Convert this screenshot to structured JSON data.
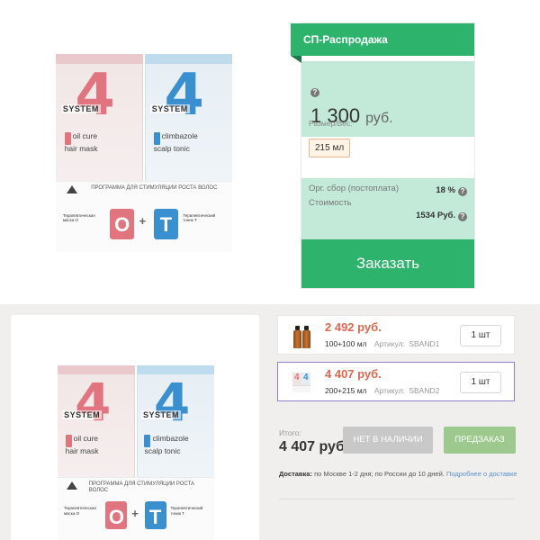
{
  "product": {
    "mask": {
      "brand": "SYSTEM",
      "digit": "4",
      "line1": "oil cure",
      "line2": "hair mask"
    },
    "tonic": {
      "brand": "SYSTEM",
      "digit": "4",
      "line1": "climbazole",
      "line2": "scalp tonic"
    },
    "program": "ПРОГРАММА ДЛЯ СТИМУЛЯЦИИ РОСТА ВОЛОС",
    "therapy_left": "Терапевтическая маска О",
    "therapy_right": "Терапевтический тоник Т",
    "glyph_o": "O",
    "glyph_t": "T",
    "plus": "+"
  },
  "card": {
    "header": "СП-Распродажа",
    "price": "1 300",
    "currency": "руб.",
    "size_label": "Размер/Вес:",
    "size_value": "215 мл",
    "fee_label": "Орг. сбор (постоплата)",
    "fee_value": "18 %",
    "cost_label": "Стоимость",
    "cost_value": "1534 Руб.",
    "order_label": "Заказать",
    "help_glyph": "?"
  },
  "variants": [
    {
      "price": "2 492 руб.",
      "volume": "100+100 мл",
      "article_label": "Артикул:",
      "article": "SBAND1",
      "qty": "1 шт",
      "selected": false
    },
    {
      "price": "4 407 руб.",
      "volume": "200+215 мл",
      "article_label": "Артикул:",
      "article": "SBAND2",
      "qty": "1 шт",
      "selected": true
    }
  ],
  "summary": {
    "total_label": "Итого:",
    "total_value": "4 407 руб.",
    "out_of_stock": "НЕТ В НАЛИЧИИ",
    "preorder": "ПРЕДЗАКАЗ",
    "delivery_label": "Доставка:",
    "delivery_text": "по Москве 1-2 дня; по России до 10 дней.",
    "delivery_link": "Подробнее о доставке"
  },
  "colors": {
    "accent_green": "#2eb36d",
    "price_red": "#e0664d",
    "mint": "#c3ead8",
    "selected_border": "#8f7fc7"
  }
}
